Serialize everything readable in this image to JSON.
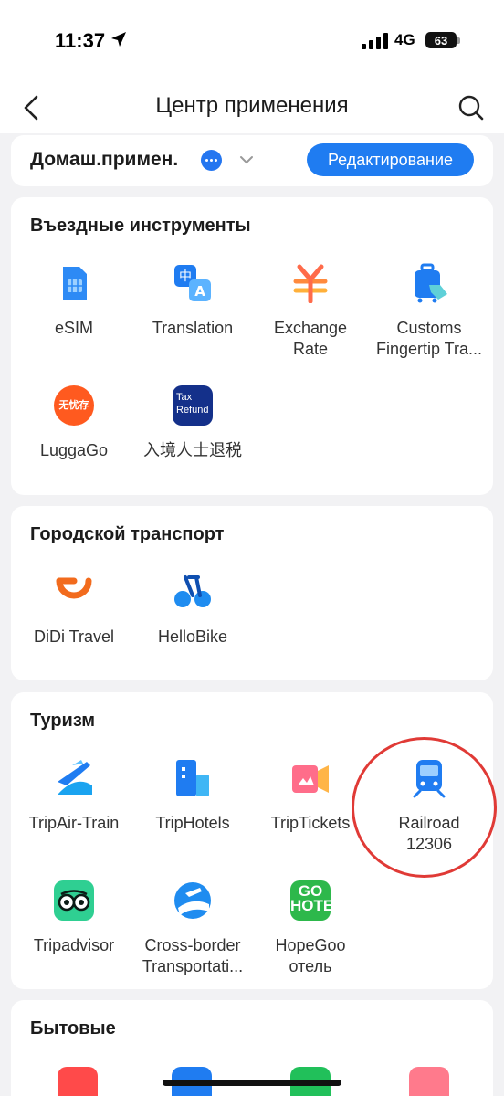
{
  "status": {
    "time": "11:37",
    "network": "4G",
    "battery": "63"
  },
  "nav": {
    "title": "Центр применения"
  },
  "category": {
    "title": "Домаш.примен.",
    "edit_label": "Редактирование"
  },
  "sections": [
    {
      "title": "Въездные инструменты",
      "apps": [
        {
          "label": "eSIM",
          "icon": "esim-icon"
        },
        {
          "label": "Translation",
          "icon": "translation-icon"
        },
        {
          "label": "Exchange\nRate",
          "icon": "exchange-rate-icon"
        },
        {
          "label": "Customs\nFingertip Tra...",
          "icon": "customs-luggage-icon"
        },
        {
          "label": "LuggaGo",
          "icon": "luggago-icon",
          "icon_text": "无忧存"
        },
        {
          "label": "入境人士退税",
          "icon": "tax-refund-icon",
          "icon_text": "Tax\nRefund"
        }
      ]
    },
    {
      "title": "Городской транспорт",
      "apps": [
        {
          "label": "DiDi Travel",
          "icon": "didi-icon"
        },
        {
          "label": "HelloBike",
          "icon": "hellobike-icon"
        }
      ]
    },
    {
      "title": "Туризм",
      "apps": [
        {
          "label": "TripAir-Train",
          "icon": "plane-train-icon"
        },
        {
          "label": "TripHotels",
          "icon": "hotel-building-icon"
        },
        {
          "label": "TripTickets",
          "icon": "ticket-icon"
        },
        {
          "label": "Railroad\n12306",
          "icon": "train-icon"
        },
        {
          "label": "Tripadvisor",
          "icon": "tripadvisor-icon"
        },
        {
          "label": "Cross-border\nTransportati...",
          "icon": "cross-border-icon"
        },
        {
          "label": "HopeGoo\nотель",
          "icon": "hopegoo-icon",
          "icon_text": "GO\nHOTEL"
        }
      ]
    },
    {
      "title": "Бытовые",
      "apps": []
    }
  ],
  "colors": {
    "accent": "#1f7cf1",
    "highlight": "#e03a36",
    "background": "#f2f2f4"
  }
}
